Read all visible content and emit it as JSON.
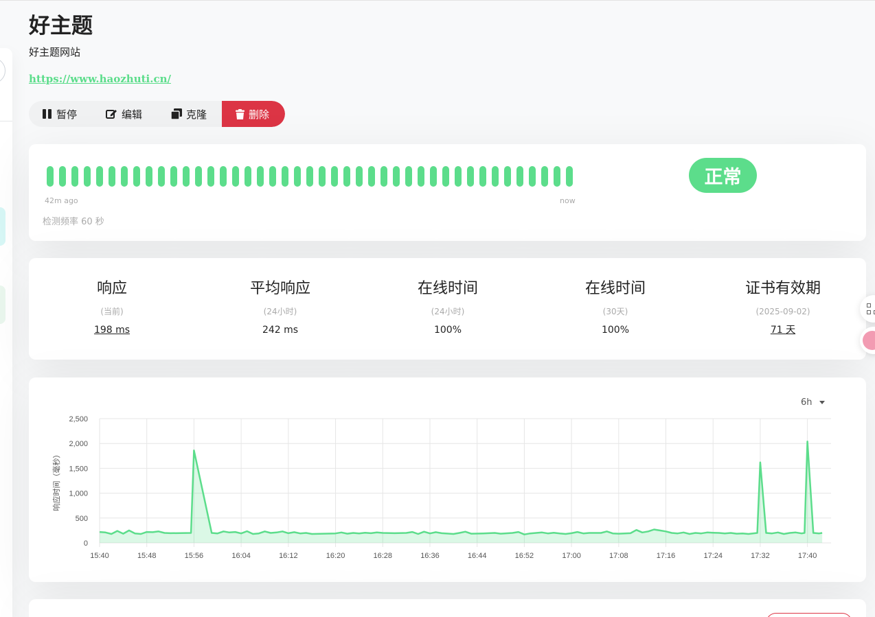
{
  "monitor": {
    "name": "好主题",
    "description": "好主题网站",
    "url": "https://www.haozhuti.cn/"
  },
  "actions": {
    "pause": "暂停",
    "edit": "编辑",
    "clone": "克隆",
    "delete": "删除"
  },
  "heartbeat": {
    "beats": [
      "up",
      "up",
      "up",
      "up",
      "up",
      "up",
      "up",
      "up",
      "up",
      "up",
      "up",
      "up",
      "up",
      "up",
      "up",
      "up",
      "up",
      "up",
      "up",
      "up",
      "up",
      "up",
      "up",
      "up",
      "up",
      "up",
      "up",
      "up",
      "up",
      "up",
      "up",
      "up",
      "up",
      "up",
      "up",
      "up",
      "up",
      "up",
      "up",
      "up",
      "up",
      "up",
      "up"
    ],
    "start_label": "42m ago",
    "end_label": "now",
    "interval_text": "检测频率 60 秒",
    "status": "正常",
    "up_color": "#5cdd8b"
  },
  "stats": [
    {
      "title": "响应",
      "subtitle": "(当前)",
      "value": "198 ms",
      "link": true
    },
    {
      "title": "平均响应",
      "subtitle": "(24小时)",
      "value": "242 ms",
      "link": false
    },
    {
      "title": "在线时间",
      "subtitle": "(24小时)",
      "value": "100%",
      "link": false
    },
    {
      "title": "在线时间",
      "subtitle": "(30天)",
      "value": "100%",
      "link": false
    },
    {
      "title": "证书有效期",
      "subtitle": "(2025-09-02)",
      "value": "71 天",
      "link": true
    }
  ],
  "period": {
    "selected": "6h"
  },
  "chart_data": {
    "type": "area",
    "ylabel": "响应时间（毫秒）",
    "xlabel": "",
    "ylim": [
      0,
      2500
    ],
    "yticks": [
      0,
      500,
      1000,
      1500,
      2000,
      2500
    ],
    "ytick_labels": [
      "0",
      "500",
      "1,000",
      "1,500",
      "2,000",
      "2,500"
    ],
    "xtick_labels": [
      "15:40",
      "15:48",
      "15:56",
      "16:04",
      "16:12",
      "16:20",
      "16:28",
      "16:36",
      "16:44",
      "16:52",
      "17:00",
      "17:08",
      "17:16",
      "17:24",
      "17:32",
      "17:40"
    ],
    "xlim_minutes": [
      0,
      124
    ],
    "grid": true,
    "series": [
      {
        "color": "#5cdd8b",
        "fill": "rgba(92,221,139,0.22)",
        "points": [
          [
            0,
            220
          ],
          [
            1,
            210
          ],
          [
            2,
            180
          ],
          [
            3,
            240
          ],
          [
            4,
            185
          ],
          [
            5,
            250
          ],
          [
            6,
            190
          ],
          [
            7,
            180
          ],
          [
            8,
            220
          ],
          [
            9,
            215
          ],
          [
            10,
            230
          ],
          [
            11,
            200
          ],
          [
            12,
            195
          ],
          [
            15.5,
            200
          ],
          [
            16,
            1860
          ],
          [
            19,
            200
          ],
          [
            20,
            190
          ],
          [
            21,
            230
          ],
          [
            22,
            210
          ],
          [
            23,
            220
          ],
          [
            24,
            190
          ],
          [
            25,
            235
          ],
          [
            26,
            180
          ],
          [
            27,
            190
          ],
          [
            28,
            230
          ],
          [
            29,
            200
          ],
          [
            30,
            210
          ],
          [
            31,
            230
          ],
          [
            32,
            195
          ],
          [
            33,
            215
          ],
          [
            34,
            190
          ],
          [
            35,
            200
          ],
          [
            36,
            180
          ],
          [
            38,
            185
          ],
          [
            40,
            190
          ],
          [
            41,
            210
          ],
          [
            42,
            185
          ],
          [
            43,
            200
          ],
          [
            44,
            190
          ],
          [
            45,
            205
          ],
          [
            46,
            195
          ],
          [
            47,
            210
          ],
          [
            48,
            200
          ],
          [
            50,
            195
          ],
          [
            52,
            200
          ],
          [
            53,
            220
          ],
          [
            54,
            180
          ],
          [
            55,
            225
          ],
          [
            56,
            190
          ],
          [
            57,
            215
          ],
          [
            58,
            195
          ],
          [
            60,
            180
          ],
          [
            61,
            200
          ],
          [
            62,
            225
          ],
          [
            63,
            185
          ],
          [
            65,
            190
          ],
          [
            67,
            200
          ],
          [
            68,
            185
          ],
          [
            70,
            200
          ],
          [
            71,
            220
          ],
          [
            72,
            170
          ],
          [
            73,
            190
          ],
          [
            75,
            210
          ],
          [
            76,
            190
          ],
          [
            77,
            205
          ],
          [
            78,
            190
          ],
          [
            79,
            180
          ],
          [
            80,
            195
          ],
          [
            81,
            220
          ],
          [
            82,
            190
          ],
          [
            83,
            200
          ],
          [
            85,
            200
          ],
          [
            86,
            230
          ],
          [
            87,
            190
          ],
          [
            88,
            185
          ],
          [
            90,
            195
          ],
          [
            91,
            260
          ],
          [
            92,
            210
          ],
          [
            93,
            230
          ],
          [
            94,
            270
          ],
          [
            95,
            250
          ],
          [
            96,
            230
          ],
          [
            97,
            200
          ],
          [
            98,
            190
          ],
          [
            99,
            210
          ],
          [
            100,
            180
          ],
          [
            101,
            200
          ],
          [
            102,
            190
          ],
          [
            103,
            210
          ],
          [
            104,
            205
          ],
          [
            105,
            200
          ],
          [
            106,
            190
          ],
          [
            107,
            200
          ],
          [
            108,
            185
          ],
          [
            109,
            190
          ],
          [
            110,
            180
          ],
          [
            111.5,
            200
          ],
          [
            112,
            1620
          ],
          [
            113,
            200
          ],
          [
            114,
            190
          ],
          [
            115,
            210
          ],
          [
            116,
            180
          ],
          [
            117,
            200
          ],
          [
            118,
            210
          ],
          [
            119,
            190
          ],
          [
            119.5,
            200
          ],
          [
            120,
            2040
          ],
          [
            121,
            200
          ],
          [
            122,
            190
          ],
          [
            122.5,
            200
          ]
        ]
      }
    ]
  }
}
